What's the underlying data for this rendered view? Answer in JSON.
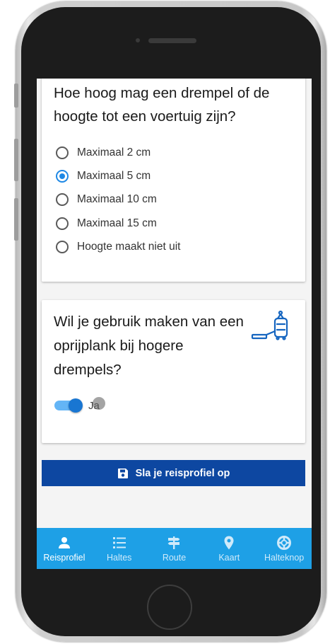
{
  "question1": {
    "title": "Hoe hoog mag een drempel of de hoogte tot een voertuig zijn?",
    "options": [
      {
        "label": "Maximaal 2 cm",
        "selected": false
      },
      {
        "label": "Maximaal 5 cm",
        "selected": true
      },
      {
        "label": "Maximaal 10 cm",
        "selected": false
      },
      {
        "label": "Maximaal 15 cm",
        "selected": false
      },
      {
        "label": "Hoogte maakt niet uit",
        "selected": false
      }
    ]
  },
  "question2": {
    "title": "Wil je gebruik maken van een oprijplank bij hogere drempels?",
    "icon": "ramp-vehicle-icon",
    "toggle": {
      "label": "Ja",
      "on": true
    }
  },
  "save_button": {
    "label": "Sla je reisprofiel op",
    "icon": "save-icon"
  },
  "nav": {
    "items": [
      {
        "label": "Reisprofiel",
        "icon": "person-icon",
        "active": true
      },
      {
        "label": "Haltes",
        "icon": "list-icon",
        "active": false
      },
      {
        "label": "Route",
        "icon": "signpost-icon",
        "active": false
      },
      {
        "label": "Kaart",
        "icon": "map-pin-icon",
        "active": false
      },
      {
        "label": "Halteknop",
        "icon": "lifebuoy-icon",
        "active": false
      }
    ]
  },
  "colors": {
    "accent": "#1e88e5",
    "primary_button": "#0d47a1",
    "nav_background": "#1ea0e6"
  }
}
